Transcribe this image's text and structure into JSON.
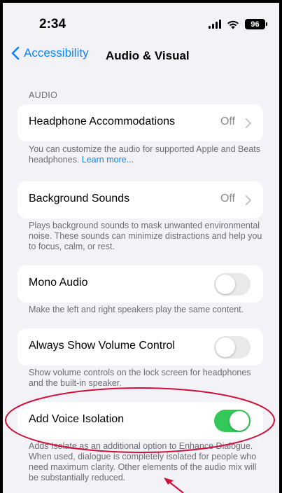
{
  "status_bar": {
    "time": "2:34",
    "battery": "96",
    "signal_icon": "signal-icon",
    "wifi_icon": "wifi-icon"
  },
  "nav": {
    "back_label": "Accessibility",
    "title": "Audio & Visual"
  },
  "section": {
    "header": "AUDIO"
  },
  "rows": {
    "headphone": {
      "label": "Headphone Accommodations",
      "value": "Off"
    },
    "headphone_footer": {
      "text": "You can customize the audio for supported Apple and Beats headphones.",
      "link": "Learn more..."
    },
    "background": {
      "label": "Background Sounds",
      "value": "Off"
    },
    "background_footer": "Plays background sounds to mask unwanted environmental noise. These sounds can minimize distractions and help you to focus, calm, or rest.",
    "mono": {
      "label": "Mono Audio",
      "on": false
    },
    "mono_footer": "Make the left and right speakers play the same content.",
    "volume": {
      "label": "Always Show Volume Control",
      "on": false
    },
    "volume_footer": "Show volume controls on the lock screen for headphones and the built-in speaker.",
    "voice": {
      "label": "Add Voice Isolation",
      "on": true
    },
    "voice_footer": "Adds Isolate as an additional option to Enhance Dialogue. When used, dialogue is completely isolated for people who need maximum clarity. Other elements of the audio mix will be substantially reduced."
  },
  "colors": {
    "accent": "#0a84ff",
    "toggle_on": "#34c759",
    "annotation": "#d0103a",
    "background": "#f2f2f7"
  }
}
